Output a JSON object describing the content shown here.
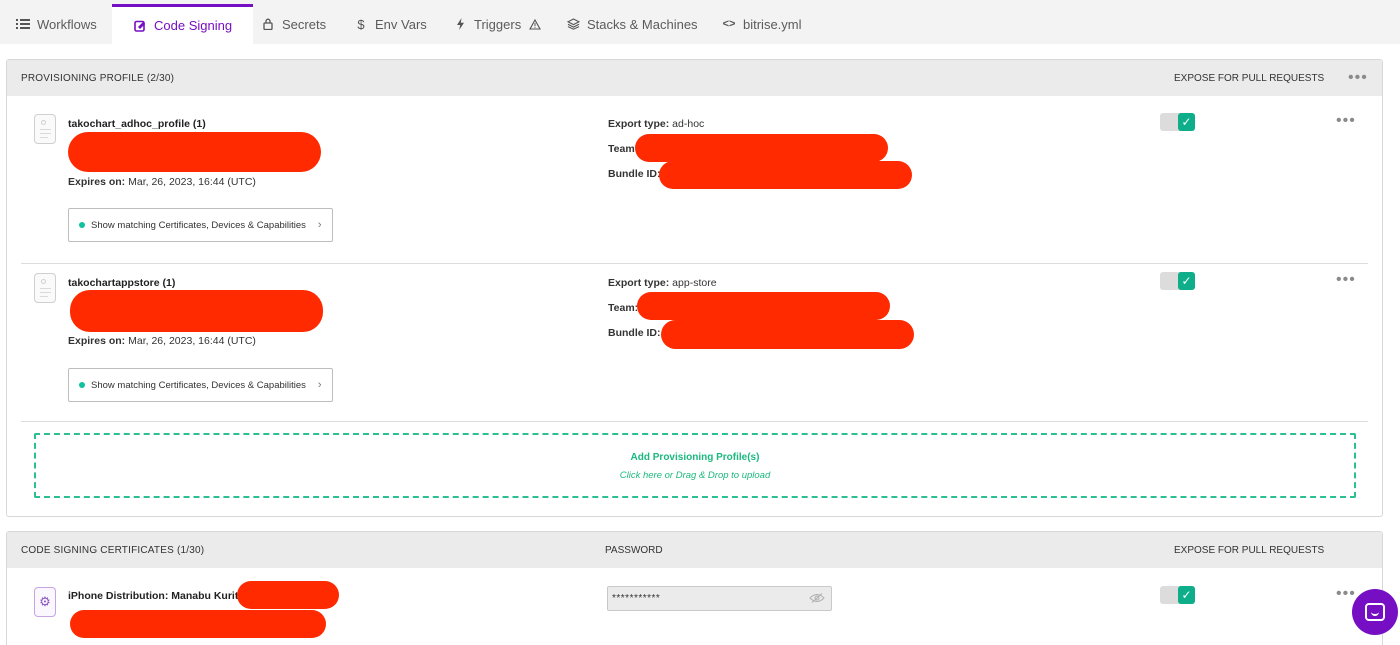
{
  "tabs": [
    {
      "label": "Workflows",
      "icon": "list-icon"
    },
    {
      "label": "Code Signing",
      "icon": "signing-icon",
      "active": true
    },
    {
      "label": "Secrets",
      "icon": "lock-icon"
    },
    {
      "label": "Env Vars",
      "icon": "dollar-icon"
    },
    {
      "label": "Triggers",
      "icon": "bolt-icon",
      "badge": "warning-icon"
    },
    {
      "label": "Stacks & Machines",
      "icon": "stack-icon"
    },
    {
      "label": "bitrise.yml",
      "icon": "code-icon"
    }
  ],
  "provisioning": {
    "header_title": "PROVISIONING PROFILE (2/30)",
    "header_expose": "EXPOSE FOR PULL REQUESTS",
    "profiles": [
      {
        "name": "takochart_adhoc_profile (1)",
        "expires_label": "Expires on:",
        "expires_value": " Mar, 26, 2023, 16:44 (UTC)",
        "match_button": "Show matching Certificates, Devices & Capabilities",
        "export_label": "Export type:",
        "export_value": " ad-hoc",
        "team_label": "Team:",
        "bundle_label": "Bundle ID:",
        "exposed": true
      },
      {
        "name": "takochartappstore (1)",
        "expires_label": "Expires on:",
        "expires_value": " Mar, 26, 2023, 16:44 (UTC)",
        "match_button": "Show matching Certificates, Devices & Capabilities",
        "export_label": "Export type:",
        "export_value": " app-store",
        "team_label": "Team:",
        "bundle_label": "Bundle ID:",
        "exposed": true
      }
    ],
    "upload_title": "Add Provisioning Profile(s)",
    "upload_subtitle": "Click here or Drag & Drop to upload"
  },
  "certificates": {
    "header_title": "CODE SIGNING CERTIFICATES (1/30)",
    "header_password": "PASSWORD",
    "header_expose": "EXPOSE FOR PULL REQUESTS",
    "items": [
      {
        "name": "iPhone Distribution: Manabu Kurita",
        "password_mask": "***********",
        "exposed": true
      }
    ]
  },
  "colors": {
    "accent": "#760fc3",
    "success": "#0dae89",
    "redaction": "#ff2a00"
  }
}
